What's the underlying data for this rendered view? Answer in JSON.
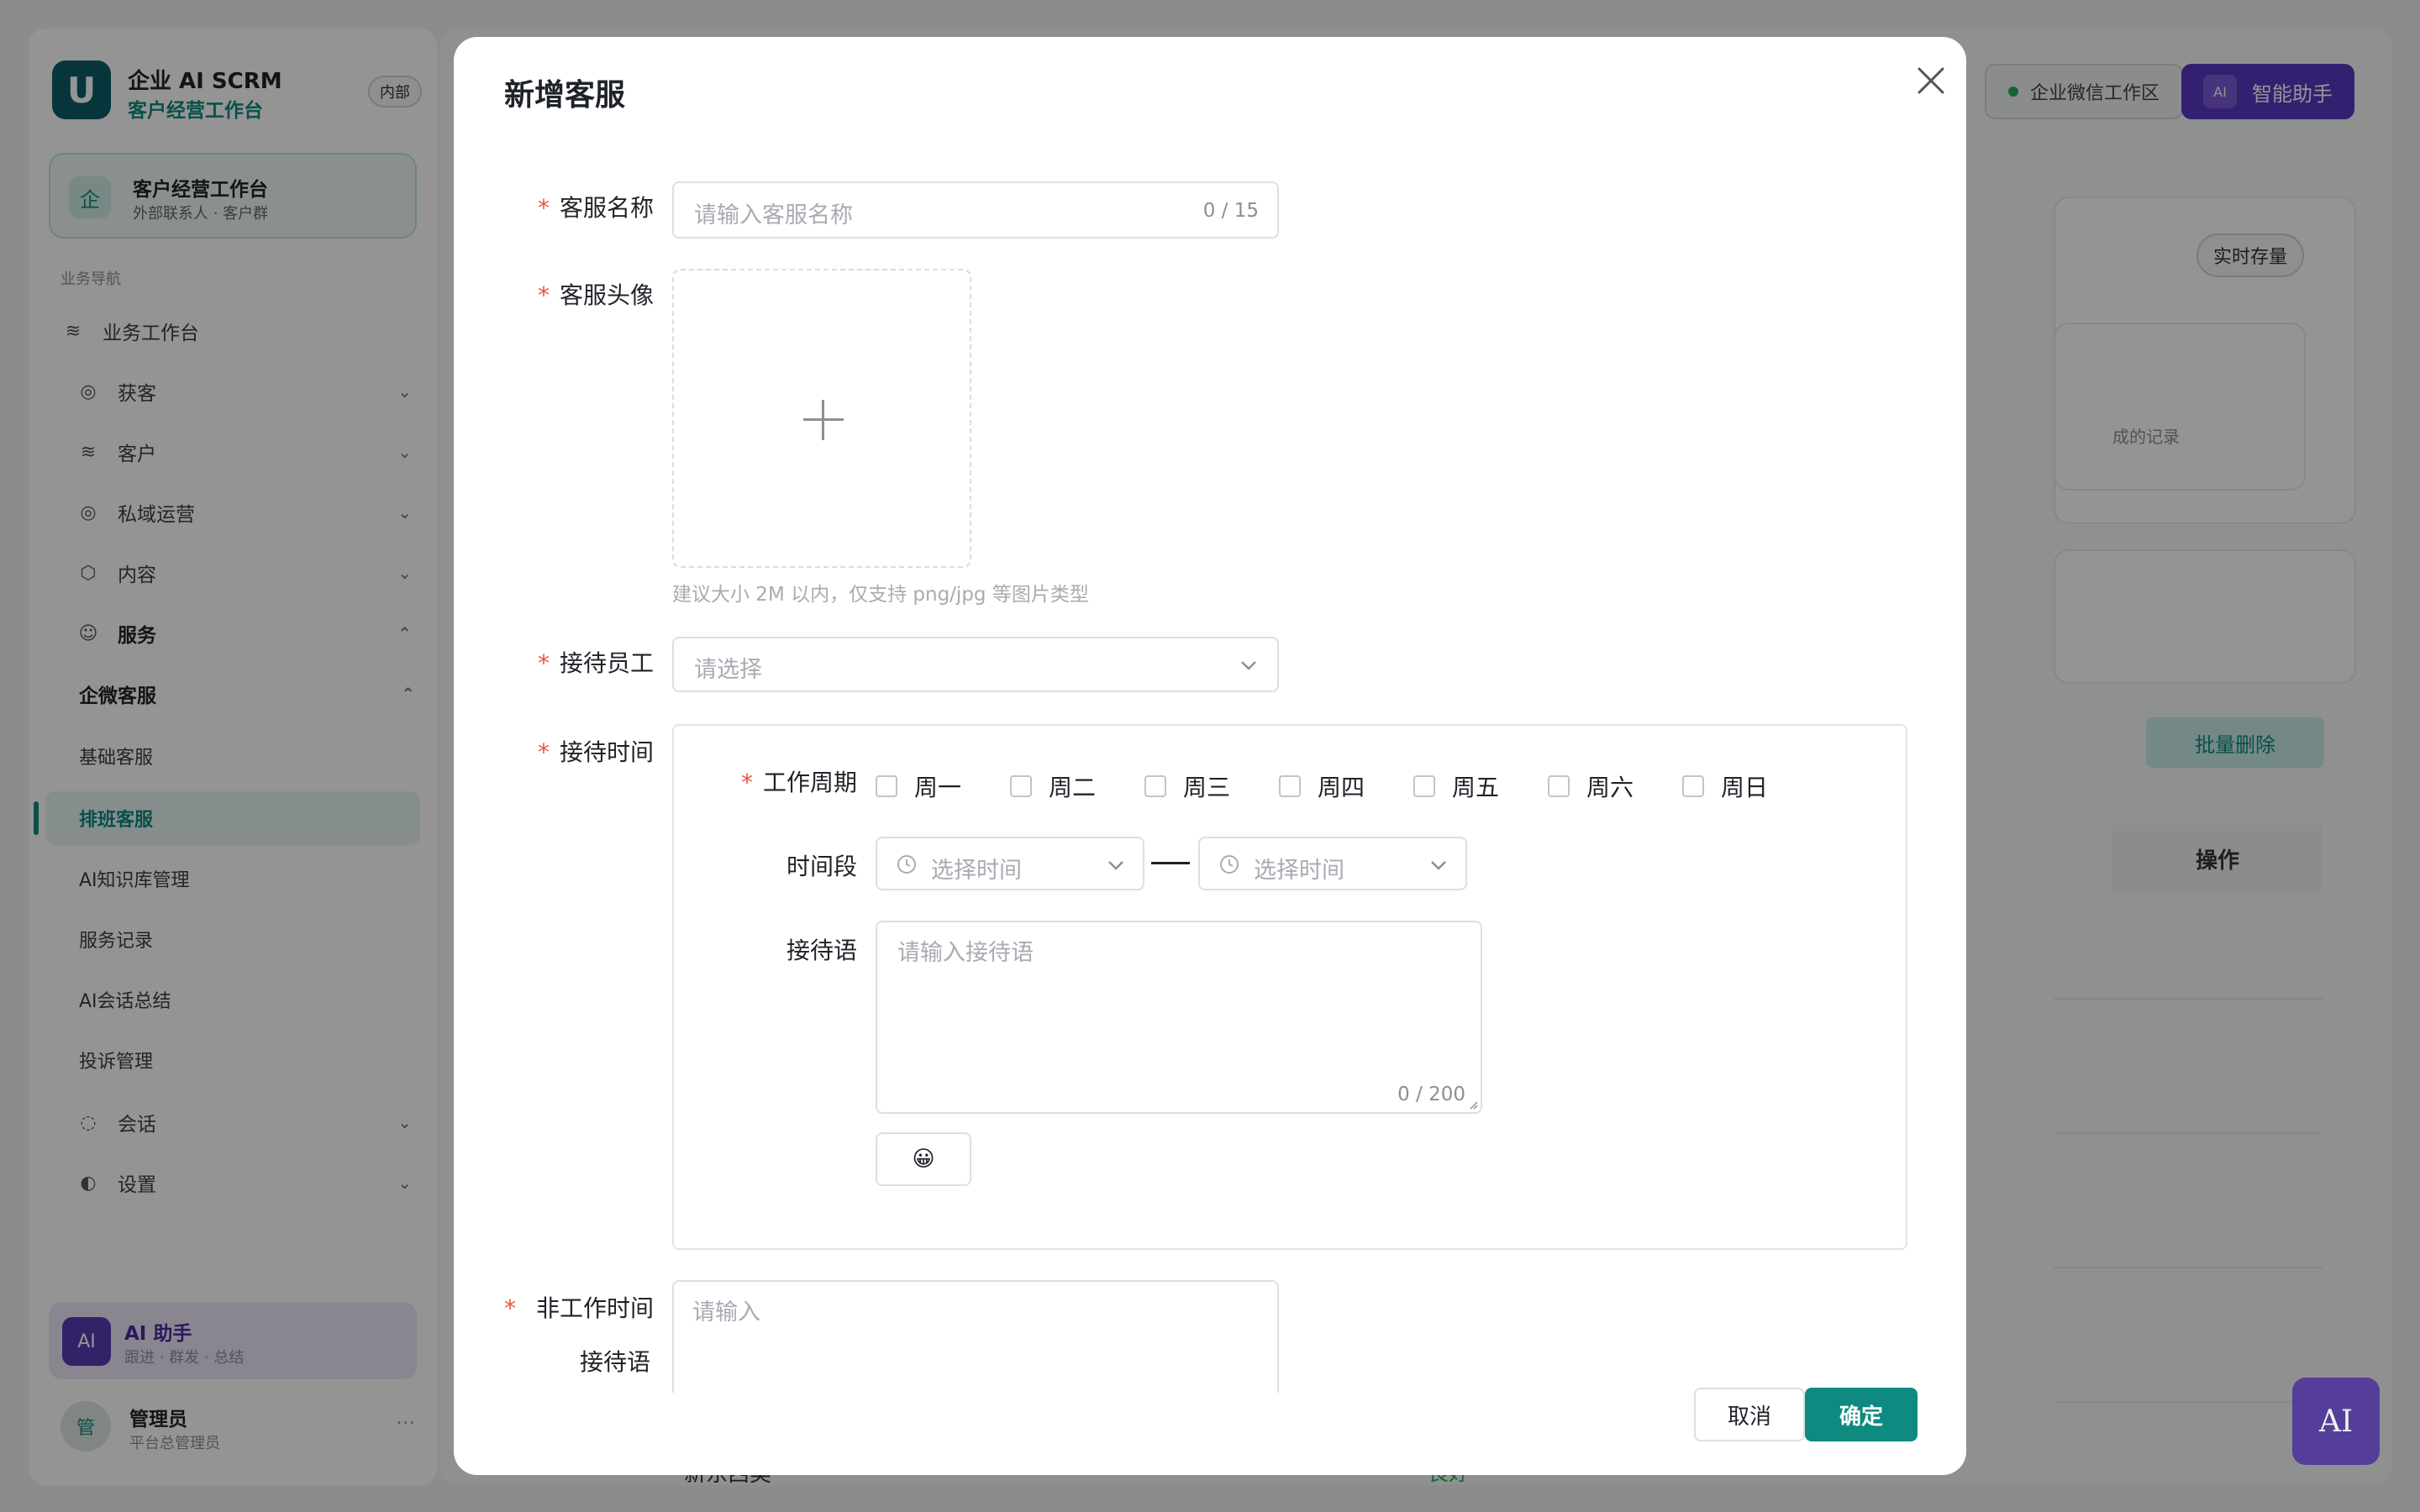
{
  "brand": {
    "title": "企业 AI SCRM",
    "subtitle": "客户经营工作台",
    "badge": "内部",
    "logo_letter": "U"
  },
  "workspace": {
    "icon": "企",
    "title": "客户经营工作台",
    "subtitle": "外部联系人 · 客户群"
  },
  "nav": {
    "section_label": "业务导航",
    "workbench": "业务工作台",
    "groups": [
      {
        "label": "获客",
        "icon": "target-icon"
      },
      {
        "label": "客户",
        "icon": "layers-icon"
      },
      {
        "label": "私域运营",
        "icon": "target-icon"
      },
      {
        "label": "内容",
        "icon": "box-icon"
      },
      {
        "label": "服务",
        "icon": "smile-icon"
      }
    ],
    "service_sub_group": "企微客服",
    "service_items": [
      "基础客服",
      "排班客服",
      "AI知识库管理",
      "服务记录",
      "AI会话总结",
      "投诉管理"
    ],
    "active_item": "排班客服",
    "more_groups": [
      {
        "label": "会话",
        "icon": "chat-icon"
      },
      {
        "label": "设置",
        "icon": "settings-icon"
      }
    ]
  },
  "assistant_card": {
    "avatar": "AI",
    "title": "AI 助手",
    "subtitle": "跟进 · 群发 · 总结"
  },
  "user": {
    "avatar": "管",
    "name": "管理员",
    "role": "平台总管理员",
    "more": "···"
  },
  "topbar": {
    "wecom_label": "企业微信工作区",
    "ai_badge": "AI",
    "ai_label": "智能助手"
  },
  "background": {
    "tag": "实时存量",
    "record_hint": "成的记录",
    "batch_delete": "批量删除",
    "op_header": "操作",
    "row_text": "新东西类",
    "row_tag": "良好"
  },
  "fab": "AI",
  "modal": {
    "title": "新增客服",
    "name_field": {
      "label": "客服名称",
      "placeholder": "请输入客服名称",
      "counter": "0 / 15"
    },
    "avatar_field": {
      "label": "客服头像",
      "hint": "建议大小 2M 以内，仅支持 png/jpg 等图片类型"
    },
    "staff_field": {
      "label": "接待员工",
      "placeholder": "请选择"
    },
    "time_field": {
      "label": "接待时间",
      "cycle_label": "工作周期",
      "days": [
        "周一",
        "周二",
        "周三",
        "周四",
        "周五",
        "周六",
        "周日"
      ],
      "period_label": "时间段",
      "start_placeholder": "选择时间",
      "end_placeholder": "选择时间",
      "greeting_label": "接待语",
      "greeting_placeholder": "请输入接待语",
      "greeting_counter": "0 / 200",
      "emoji": "😀"
    },
    "offhours_field": {
      "label_line1": "非工作时间",
      "label_line2": "接待语",
      "placeholder": "请输入"
    },
    "cancel_label": "取消",
    "ok_label": "确定"
  },
  "colors": {
    "primary": "#0e8a80",
    "required": "#e8553d",
    "ai_purple": "#5a38c2"
  }
}
